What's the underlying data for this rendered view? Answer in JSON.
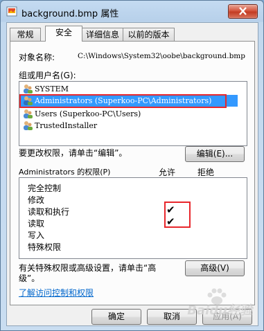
{
  "window": {
    "title": "background.bmp 属性"
  },
  "tabs": [
    {
      "label": "常规"
    },
    {
      "label": "安全"
    },
    {
      "label": "详细信息"
    },
    {
      "label": "以前的版本"
    }
  ],
  "security": {
    "object_name_label": "对象名称:",
    "object_name_value": "C:\\Windows\\System32\\oobe\\background.bmp",
    "groups_label": "组或用户名(G):",
    "principals": [
      {
        "name": "SYSTEM",
        "icon": "users-icon"
      },
      {
        "name": "Administrators (Superkoo-PC\\Administrators)",
        "icon": "users-icon"
      },
      {
        "name": "Users (Superkoo-PC\\Users)",
        "icon": "users-icon"
      },
      {
        "name": "TrustedInstaller",
        "icon": "users-icon"
      }
    ],
    "selected_principal_index": 1,
    "edit_hint": "要更改权限，请单击“编辑”。",
    "edit_button": "编辑(E)...",
    "permissions_header": "Administrators 的权限(P)",
    "allow_header": "允许",
    "deny_header": "拒绝",
    "permissions": [
      {
        "name": "完全控制",
        "allow": "",
        "deny": ""
      },
      {
        "name": "修改",
        "allow": "",
        "deny": ""
      },
      {
        "name": "读取和执行",
        "allow": "✔",
        "deny": ""
      },
      {
        "name": "读取",
        "allow": "✔",
        "deny": ""
      },
      {
        "name": "写入",
        "allow": "",
        "deny": ""
      },
      {
        "name": "特殊权限",
        "allow": "",
        "deny": ""
      }
    ],
    "advanced_hint_line1": "有关特殊权限或高级设置，请单击“高",
    "advanced_hint_line2": "级”。",
    "advanced_button": "高级(V)",
    "learn_link": "了解访问控制和权限"
  },
  "footer": {
    "ok": "确定",
    "cancel": "取消",
    "apply": "应用(A)"
  },
  "watermark": {
    "text": "Baidu经验"
  },
  "colors": {
    "selection": "#3399ff",
    "highlight": "#e8262b",
    "link": "#0066cc"
  }
}
